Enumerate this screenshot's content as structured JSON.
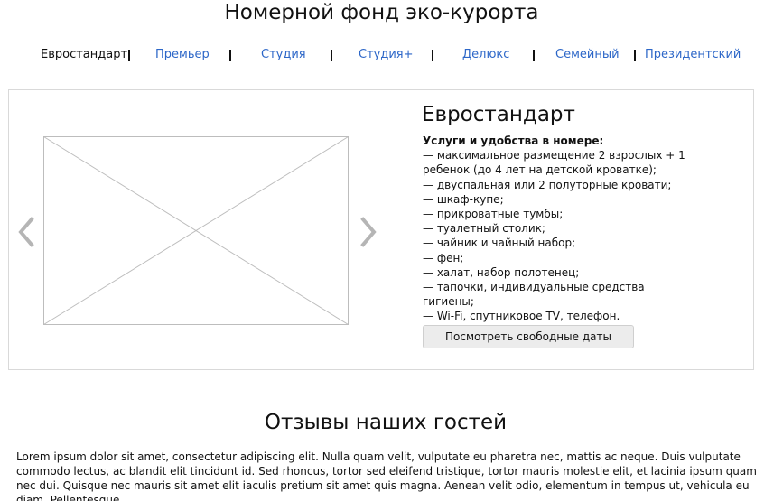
{
  "page": {
    "title": "Номерной фонд эко-курорта"
  },
  "tabs": [
    {
      "label": "Евростандарт",
      "active": true
    },
    {
      "label": "Премьер",
      "active": false
    },
    {
      "label": "Студия",
      "active": false
    },
    {
      "label": "Студия+",
      "active": false
    },
    {
      "label": "Делюкс",
      "active": false
    },
    {
      "label": "Семейный",
      "active": false
    },
    {
      "label": "Президентский",
      "active": false
    }
  ],
  "room": {
    "title": "Евростандарт",
    "amenities_heading": "Услуги и удобства в номере:",
    "amenities": [
      "— максимальное размещение 2 взрослых + 1 ребенок (до 4 лет на детской кроватке);",
      "— двуспальная или 2 полуторные кровати;",
      "— шкаф-купе;",
      "— прикроватные тумбы;",
      "— туалетный столик;",
      "— чайник и чайный набор;",
      "— фен;",
      "— халат, набор полотенец;",
      "— тапочки, индивидуальные средства гигиены;",
      "— Wi-Fi, спутниковое TV, телефон."
    ],
    "button_label": "Посмотреть свободные даты"
  },
  "reviews": {
    "title": "Отзывы наших гостей",
    "text": "Lorem ipsum dolor sit amet, consectetur adipiscing elit. Nulla quam velit, vulputate eu pharetra nec, mattis ac neque. Duis vulputate commodo lectus, ac blandit elit tincidunt id. Sed rhoncus, tortor sed eleifend tristique, tortor mauris molestie elit, et lacinia ipsum quam nec dui. Quisque nec mauris sit amet elit iaculis pretium sit amet quis magna. Aenean velit odio, elementum in tempus ut, vehicula eu diam. Pellentesque"
  },
  "icons": {
    "prev": "chevron-left-icon",
    "next": "chevron-right-icon",
    "image": "image-placeholder-icon"
  },
  "colors": {
    "link": "#2d67c8",
    "text": "#111111",
    "arrow": "#b5b5b5",
    "panel_border": "#d9d9d9",
    "button_bg": "#ececec"
  }
}
